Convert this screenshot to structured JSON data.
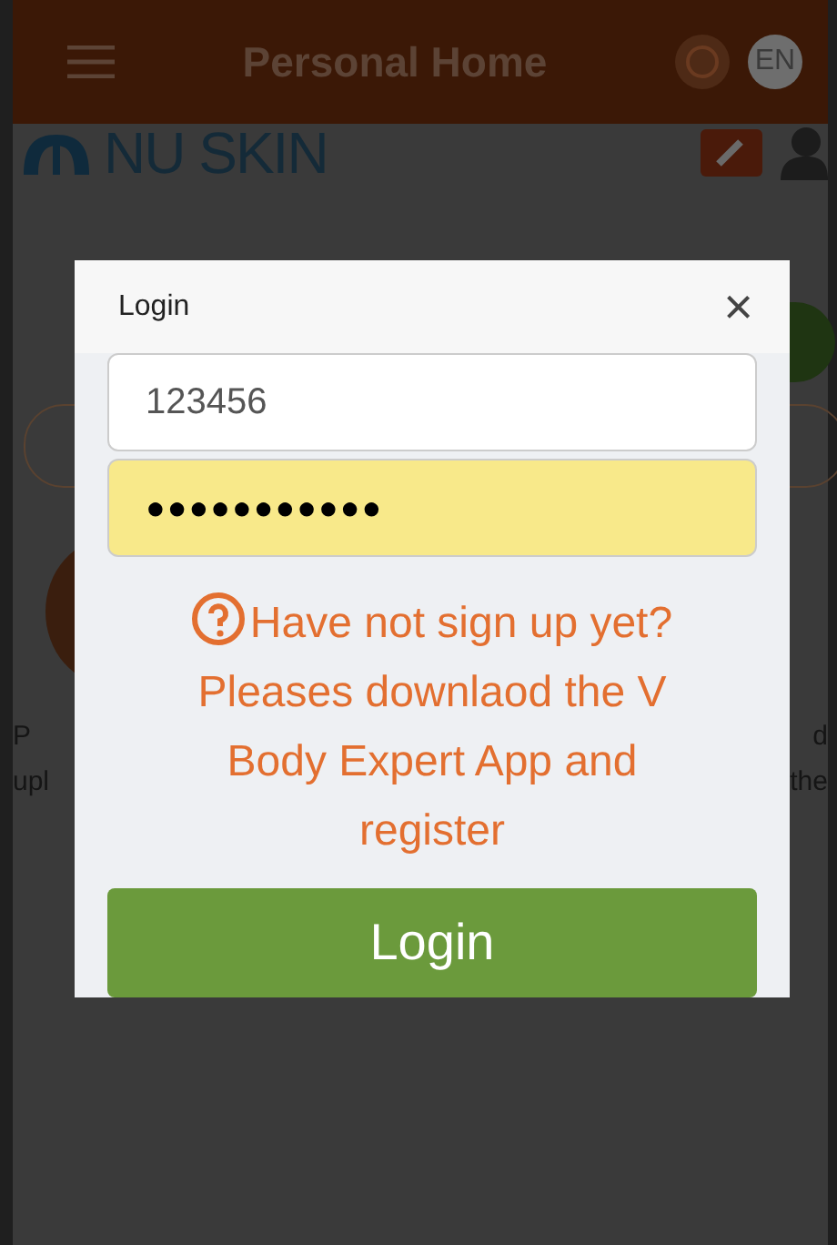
{
  "header": {
    "title": "Personal Home",
    "language": "EN"
  },
  "logo": {
    "text": "NU SKIN"
  },
  "background_text": {
    "left": [
      "P",
      "upl"
    ],
    "right": [
      "d",
      "the"
    ]
  },
  "login_dialog": {
    "title": "Login",
    "close": "×",
    "username": {
      "value": "123456"
    },
    "password": {
      "value": "●●●●●●●●●●●",
      "autofilled": true
    },
    "signup_hint": "Have not sign up yet? Pleases downlaod the V Body Expert App and register",
    "login_button": "Login"
  }
}
